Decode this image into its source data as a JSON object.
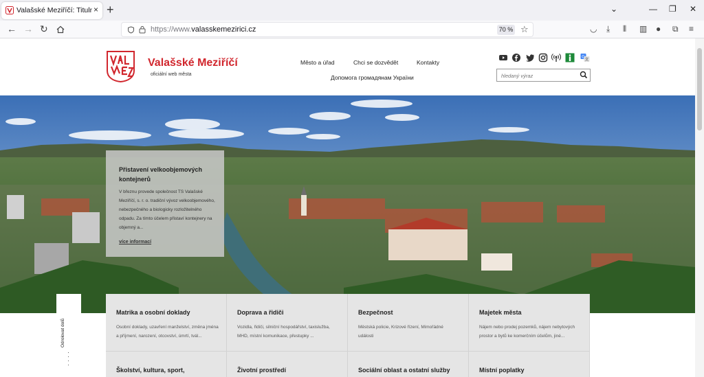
{
  "browser": {
    "tab_title": "Valašské Meziříčí: Titulní stránka",
    "url_protocol": "https://www.",
    "url_host": "valasskemezirici.cz",
    "zoom": "70 %"
  },
  "site": {
    "name": "Valašské Meziříčí",
    "subtitle": "oficiální web města",
    "nav": [
      "Město a úřad",
      "Chci se dozvědět",
      "Kontakty",
      "Допомога громадянам України"
    ],
    "search_placeholder": "hledaný výraz"
  },
  "news": {
    "title": "Přistavení velkoobjemových kontejnerů",
    "text": "V březnu provede společnost TS Valašské Meziříčí, s. r. o. tradiční vývoz velkoobjemového, nebezpečného a biologicky rozložitelného odpadu. Za tímto účelem přistaví kontejnery na objemný a...",
    "more": "více informací"
  },
  "sidetab": {
    "label": "Odrolovat dolů"
  },
  "categories": [
    {
      "title": "Matrika a osobní doklady",
      "desc": "Osobní doklady, uzavření manželství, změna jména a příjmení, narození, otcovství, úmrtí, tvál..."
    },
    {
      "title": "Doprava a řidiči",
      "desc": "Vozidla, řidiči, silniční hospodářství, taxislužba, MHD, místní komunikace, přestupky ..."
    },
    {
      "title": "Bezpečnost",
      "desc": "Městská policie, Krizové řízení, Mimořádné události"
    },
    {
      "title": "Majetek města",
      "desc": "Nájem nebo prodej pozemků, nájem nebytových prostor a bytů ke komerčním účelům, jiné..."
    },
    {
      "title": "Školství, kultura, sport,",
      "desc": ""
    },
    {
      "title": "Životní prostředí",
      "desc": ""
    },
    {
      "title": "Sociální oblast a ostatní služby",
      "desc": ""
    },
    {
      "title": "Místní poplatky",
      "desc": ""
    }
  ]
}
